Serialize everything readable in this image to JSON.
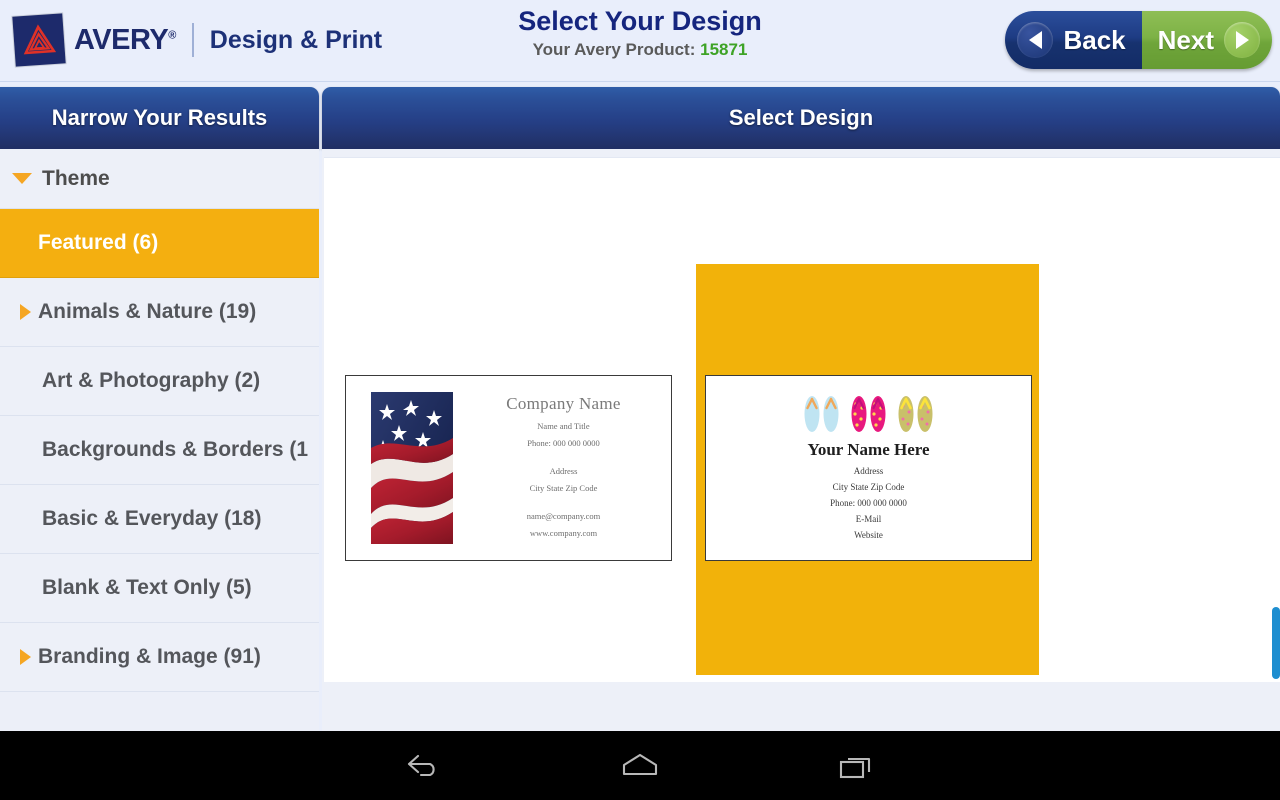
{
  "app": {
    "brand_name": "AVERY",
    "brand_trademark": "®",
    "tagline": "Design & Print",
    "logo_icon": "avery-triangle-logo"
  },
  "header": {
    "title": "Select Your Design",
    "product_label": "Your Avery Product:",
    "product_number": "15871",
    "back_label": "Back",
    "next_label": "Next",
    "back_icon": "left-arrow-icon",
    "next_icon": "right-arrow-icon",
    "colors": {
      "title": "#15257E",
      "product_number": "#3EA326",
      "back_bg": "#1E3C84",
      "next_bg": "#7DB246"
    }
  },
  "sidebar": {
    "title": "Narrow Your Results",
    "group": {
      "label": "Theme",
      "caret_icon": "caret-down-icon",
      "expanded": true
    },
    "items": [
      {
        "label": "Featured  (6)",
        "caret_icon": "none",
        "selected": true
      },
      {
        "label": "Animals & Nature  (19)",
        "caret_icon": "caret-right-icon",
        "selected": false
      },
      {
        "label": "Art & Photography  (2)",
        "caret_icon": "none",
        "selected": false
      },
      {
        "label": "Backgrounds & Borders  (1",
        "caret_icon": "none",
        "selected": false
      },
      {
        "label": "Basic & Everyday  (18)",
        "caret_icon": "none",
        "selected": false
      },
      {
        "label": "Blank & Text Only  (5)",
        "caret_icon": "none",
        "selected": false
      },
      {
        "label": "Branding & Image  (91)",
        "caret_icon": "caret-right-icon",
        "selected": false
      }
    ],
    "colors": {
      "header_bg": "#253F86",
      "selected_bg": "#F4AF10",
      "row_bg": "#EDF0F8"
    }
  },
  "main": {
    "title": "Select Design",
    "selection_color": "#F2B20A",
    "designs": [
      {
        "name": "american-flag-business-card",
        "selected": false,
        "image": "american-flag-photo",
        "lines": [
          "Company Name",
          "Name and Title",
          "Phone: 000 000 0000",
          "Address",
          "City State Zip Code",
          "name@company.com",
          "www.company.com"
        ]
      },
      {
        "name": "flip-flops-business-card",
        "selected": true,
        "image": "flip-flops-illustration",
        "lines": [
          "Your Name Here",
          "Address",
          "City State Zip Code",
          "Phone: 000 000 0000",
          "E-Mail",
          "Website"
        ]
      }
    ],
    "scrollbar_color": "#1E8ED0"
  },
  "android_nav": {
    "back_icon": "android-back-icon",
    "home_icon": "android-home-icon",
    "recent_icon": "android-recent-apps-icon"
  }
}
